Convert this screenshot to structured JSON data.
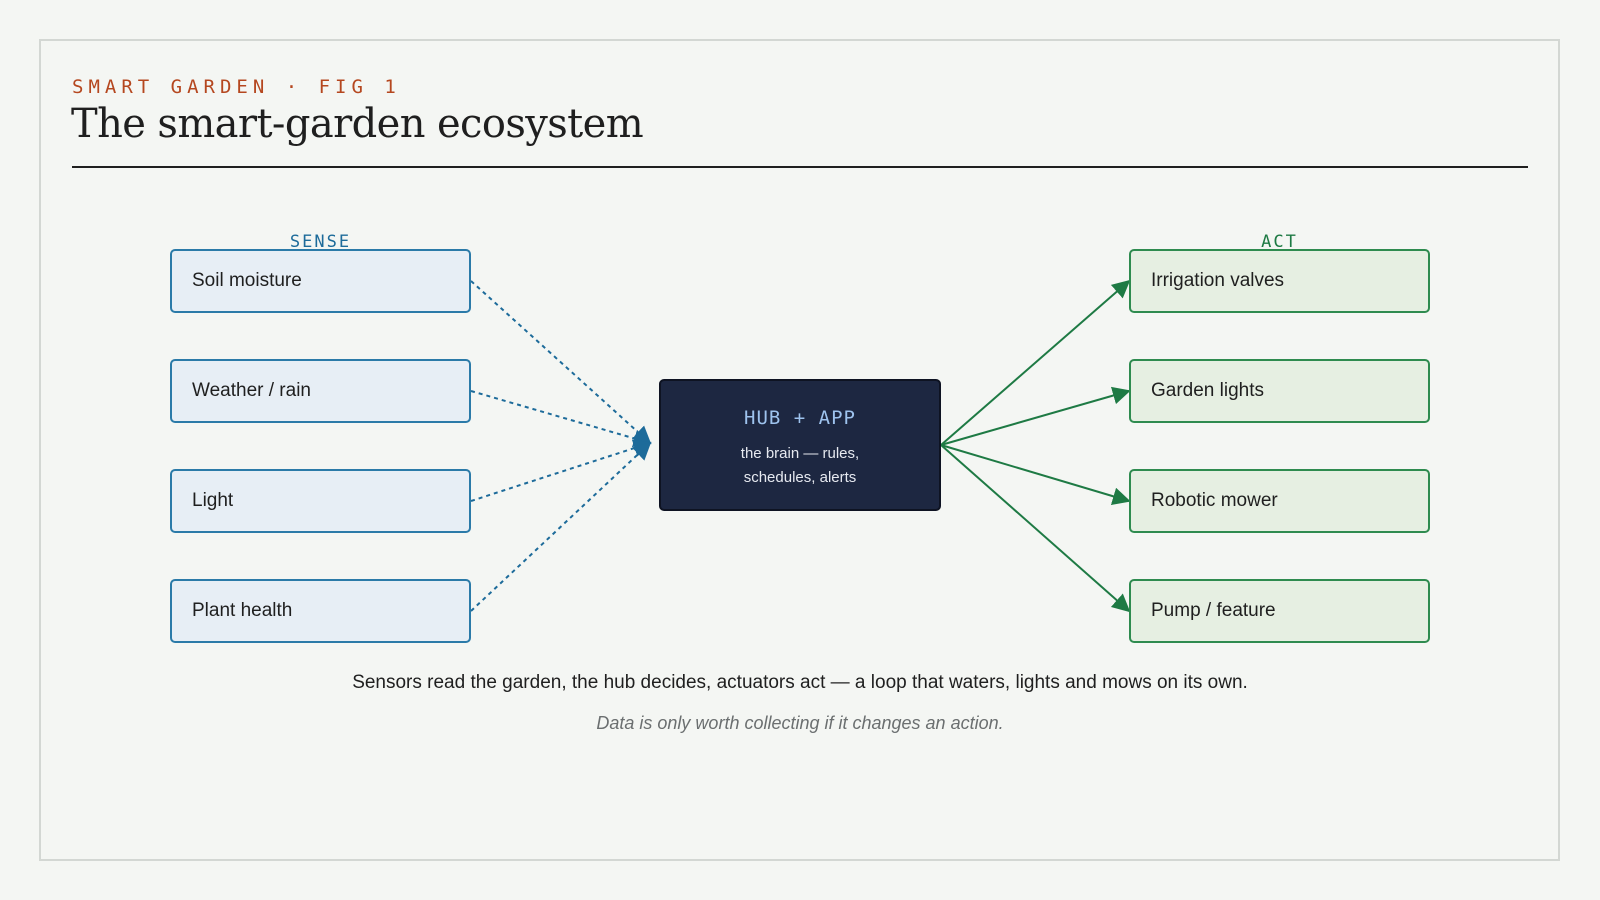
{
  "header": {
    "kicker": "SMART GARDEN · FIG 1",
    "title": "The smart-garden ecosystem"
  },
  "columns": {
    "sense": "SENSE",
    "act": "ACT"
  },
  "sensors": [
    "Soil moisture",
    "Weather / rain",
    "Light",
    "Plant health"
  ],
  "actuators": [
    "Irrigation valves",
    "Garden lights",
    "Robotic mower",
    "Pump / feature"
  ],
  "hub": {
    "title": "HUB + APP",
    "line1": "the brain — rules,",
    "line2": "schedules, alerts"
  },
  "caption": "Sensors read the garden, the hub decides, actuators act — a loop that waters, lights and mows on its own.",
  "note": "Data is only worth collecting if it changes an action.",
  "colors": {
    "sense": "#2b7aa8",
    "act": "#1e7a44",
    "hub": "#1d2741",
    "accent": "#b5471f"
  }
}
